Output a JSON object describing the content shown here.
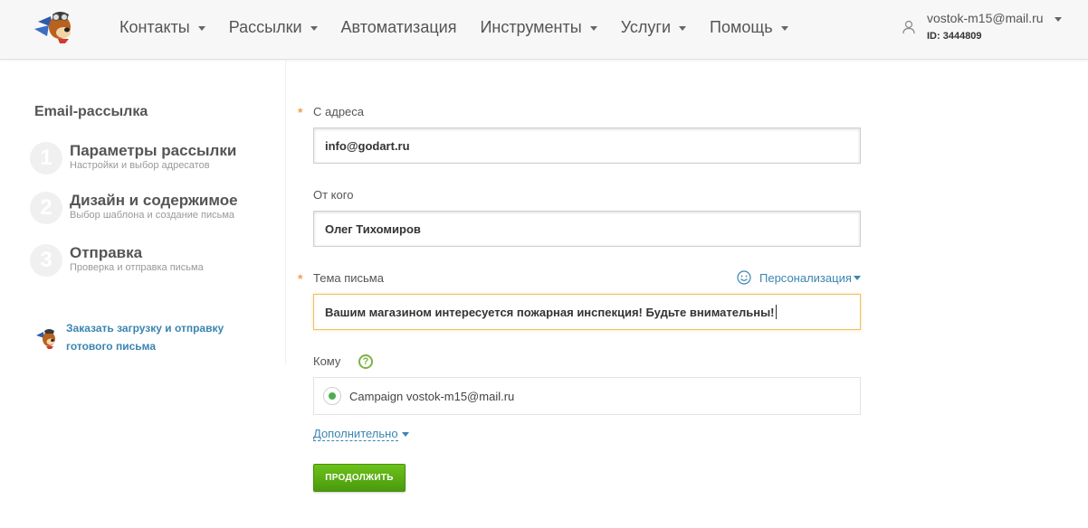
{
  "header": {
    "nav": [
      {
        "label": "Контакты",
        "dropdown": true
      },
      {
        "label": "Рассылки",
        "dropdown": true
      },
      {
        "label": "Автоматизация",
        "dropdown": false
      },
      {
        "label": "Инструменты",
        "dropdown": true
      },
      {
        "label": "Услуги",
        "dropdown": true
      },
      {
        "label": "Помощь",
        "dropdown": true
      }
    ],
    "user": {
      "email": "vostok-m15@mail.ru",
      "id": "ID: 3444809"
    }
  },
  "sidebar": {
    "title": "Email-рассылка",
    "steps": [
      {
        "num": "1",
        "title": "Параметры рассылки",
        "subtitle": "Настройки и выбор адресатов"
      },
      {
        "num": "2",
        "title": "Дизайн и содержимое",
        "subtitle": "Выбор шаблона и создание письма"
      },
      {
        "num": "3",
        "title": "Отправка",
        "subtitle": "Проверка и отправка письма"
      }
    ],
    "order_link": "Заказать загрузку и отправку готового письма"
  },
  "form": {
    "from_address_label": "С адреса",
    "from_address_value": "info@godart.ru",
    "from_name_label": "От кого",
    "from_name_value": "Олег Тихомиров",
    "subject_label": "Тема письма",
    "subject_value": "Вашим магазином интересуется пожарная инспекция! Будьте внимательны!",
    "personalization_label": "Персонализация",
    "to_label": "Кому",
    "help_symbol": "?",
    "recipient": "Campaign vostok-m15@mail.ru",
    "more_label": "Дополнительно",
    "continue_label": "ПРОДОЛЖИТЬ",
    "required_mark": "*"
  },
  "colors": {
    "accent": "#3a85b0",
    "button_green": "#5bb015",
    "required": "#f0a050",
    "radio_selected": "#4caf50"
  }
}
